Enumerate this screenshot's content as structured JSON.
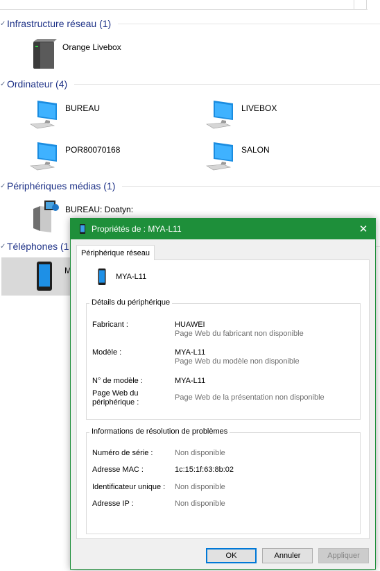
{
  "explorer": {
    "groups": [
      {
        "title": "Infrastructure réseau (1)"
      },
      {
        "title": "Ordinateur (4)"
      },
      {
        "title": "Périphériques médias (1)"
      },
      {
        "title": "Téléphones (1"
      }
    ],
    "items": {
      "router": "Orange Livebox",
      "pc1": "BUREAU",
      "pc2": "LIVEBOX",
      "pc3": "POR80070168",
      "pc4": "SALON",
      "media": "BUREAU: Doatyn:",
      "phone": "M"
    }
  },
  "dialog": {
    "title": "Propriétés de : MYA-L11",
    "close_label": "✕",
    "tab_label": "Périphérique réseau",
    "device_name": "MYA-L11",
    "details": {
      "legend": "Détails du périphérique",
      "manufacturer_label": "Fabricant :",
      "manufacturer_value": "HUAWEI",
      "manufacturer_web": "Page Web du fabricant non disponible",
      "model_label": "Modèle :",
      "model_value": "MYA-L11",
      "model_web": "Page Web du modèle non disponible",
      "model_number_label": "N° de modèle :",
      "model_number_value": "MYA-L11",
      "device_web_label_1": "Page Web du",
      "device_web_label_2": "périphérique :",
      "device_web_value": "Page Web de la présentation non disponible"
    },
    "troubleshooting": {
      "legend": "Informations de résolution de problèmes",
      "serial_label": "Numéro de série :",
      "serial_value": "Non disponible",
      "mac_label": "Adresse MAC :",
      "mac_value": "1c:15:1f:63:8b:02",
      "uid_label": "Identificateur unique :",
      "uid_value": "Non disponible",
      "ip_label": "Adresse IP :",
      "ip_value": "Non disponible"
    },
    "buttons": {
      "ok": "OK",
      "cancel": "Annuler",
      "apply": "Appliquer"
    }
  },
  "colors": {
    "accent": "#1e8f3a",
    "group_title": "#1e3287",
    "focus": "#0078d7"
  }
}
